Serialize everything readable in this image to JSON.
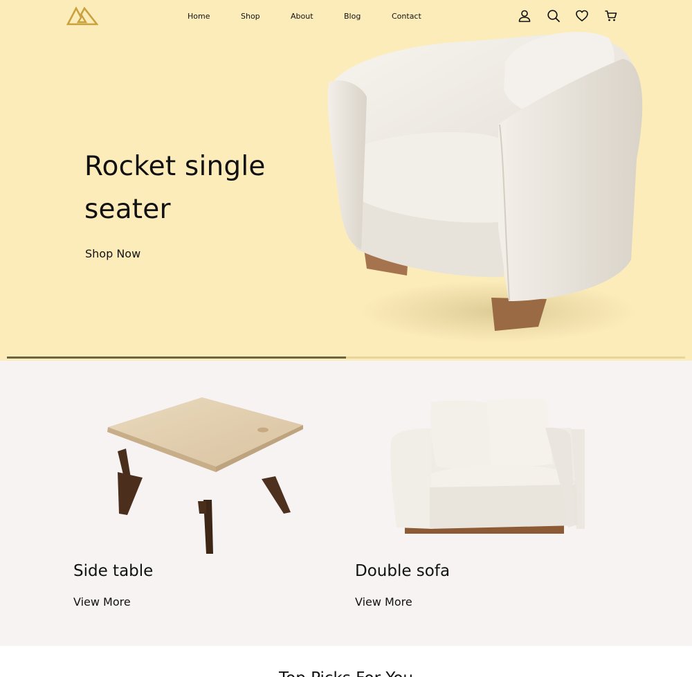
{
  "header": {
    "logo_icon": "triangle-mountain-logo",
    "nav": [
      {
        "label": "Home"
      },
      {
        "label": "Shop"
      },
      {
        "label": "About"
      },
      {
        "label": "Blog"
      },
      {
        "label": "Contact"
      }
    ],
    "icons": [
      "user-icon",
      "search-icon",
      "heart-icon",
      "cart-icon"
    ]
  },
  "hero": {
    "title": "Rocket single seater",
    "cta_label": "Shop Now",
    "slider_progress_percent": 50
  },
  "categories": [
    {
      "title": "Side table",
      "link_label": "View More"
    },
    {
      "title": "Double sofa",
      "link_label": "View More"
    }
  ],
  "next_section": {
    "title": "Top Picks For You"
  },
  "colors": {
    "hero_bg": "#fcecba",
    "category_bg": "#f8f3f3",
    "logo_gold": "#c9a23e",
    "progress_track": "#e6d69c",
    "progress_fill": "#6b6440"
  }
}
